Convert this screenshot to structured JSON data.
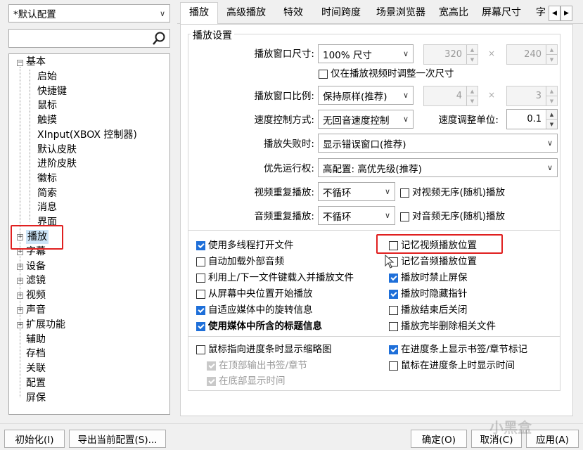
{
  "profile_select": {
    "value": "*默认配置"
  },
  "search": {
    "value": ""
  },
  "tree": {
    "root1": "基本",
    "children1": [
      "启始",
      "快捷键",
      "鼠标",
      "触摸",
      "XInput(XBOX 控制器)",
      "默认皮肤",
      "进阶皮肤",
      "徽标",
      "简索",
      "消息",
      "界面"
    ],
    "roots": [
      "播放",
      "字幕",
      "设备",
      "滤镜",
      "视频",
      "声音",
      "扩展功能",
      "辅助",
      "存档",
      "关联",
      "配置",
      "屏保"
    ]
  },
  "tabs": [
    "播放",
    "高级播放",
    "特效",
    "时间跨度",
    "场景浏览器",
    "宽高比",
    "屏幕尺寸",
    "字"
  ],
  "group_title": "播放设置",
  "window_size": {
    "label": "播放窗口尺寸:",
    "value": "100% 尺寸",
    "w": "320",
    "h": "240",
    "x": "×"
  },
  "window_size_once": "仅在播放视频时调整一次尺寸",
  "window_ratio": {
    "label": "播放窗口比例:",
    "value": "保持原样(推荐)",
    "w": "4",
    "h": "3",
    "x": "×"
  },
  "speed_mode": {
    "label": "速度控制方式:",
    "value": "无回音速度控制",
    "unit_label": "速度调整单位:",
    "unit_value": "0.1"
  },
  "fail": {
    "label": "播放失败时:",
    "value": "显示错误窗口(推荐)"
  },
  "priority": {
    "label": "优先运行权:",
    "value": "高配置: 高优先级(推荐)"
  },
  "video_repeat": {
    "label": "视频重复播放:",
    "value": "不循环",
    "check": "对视频无序(随机)播放"
  },
  "audio_repeat": {
    "label": "音频重复播放:",
    "value": "不循环",
    "check": "对音频无序(随机)播放"
  },
  "checks_left": [
    {
      "label": "使用多线程打开文件",
      "checked": true
    },
    {
      "label": "自动加载外部音频",
      "checked": false
    },
    {
      "label": "利用上/下一文件键载入并播放文件",
      "checked": false
    },
    {
      "label": "从屏幕中央位置开始播放",
      "checked": false
    },
    {
      "label": "自适应媒体中的旋转信息",
      "checked": true
    },
    {
      "label": "使用媒体中所含的标题信息",
      "checked": true
    }
  ],
  "checks_right": [
    {
      "label": "记忆视频播放位置",
      "checked": false
    },
    {
      "label": "记忆音频播放位置",
      "checked": false
    },
    {
      "label": "播放时禁止屏保",
      "checked": true
    },
    {
      "label": "播放时隐藏指针",
      "checked": true
    },
    {
      "label": "播放结束后关闭",
      "checked": false
    },
    {
      "label": "播放完毕删除相关文件",
      "checked": false
    }
  ],
  "seek_left": {
    "label": "鼠标指向进度条时显示缩略图",
    "checked": false
  },
  "seek_sub1": "在顶部输出书签/章节",
  "seek_sub2": "在底部显示时间",
  "seek_right1": {
    "label": "在进度条上显示书签/章节标记",
    "checked": true
  },
  "seek_right2": {
    "label": "鼠标在进度条上时显示时间",
    "checked": false
  },
  "buttons": {
    "init": "初始化(I)",
    "export": "导出当前配置(S)...",
    "ok": "确定(O)",
    "cancel": "取消(C)",
    "apply": "应用(A)"
  },
  "watermark": "小黑盒",
  "colors": {
    "highlight": "#e02020",
    "check": "#1e6fd9",
    "selected_bg": "#cce4f7"
  }
}
